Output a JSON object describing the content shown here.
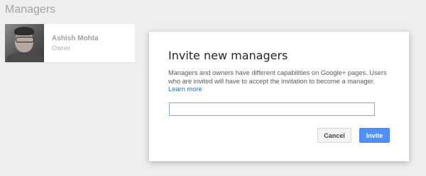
{
  "page": {
    "title": "Managers"
  },
  "manager": {
    "name": "Ashish Mohta",
    "role": "Owner"
  },
  "dialog": {
    "title": "Invite new managers",
    "description": "Managers and owners have different capabilities on Google+ pages. Users who are invited will have to accept the invitation to become a manager.",
    "learn_more": "Learn more",
    "input_value": "",
    "input_placeholder": "",
    "cancel_label": "Cancel",
    "invite_label": "Invite"
  },
  "colors": {
    "background": "#eeeeee",
    "accent": "#4d90fe",
    "link": "#2d6fd6"
  }
}
